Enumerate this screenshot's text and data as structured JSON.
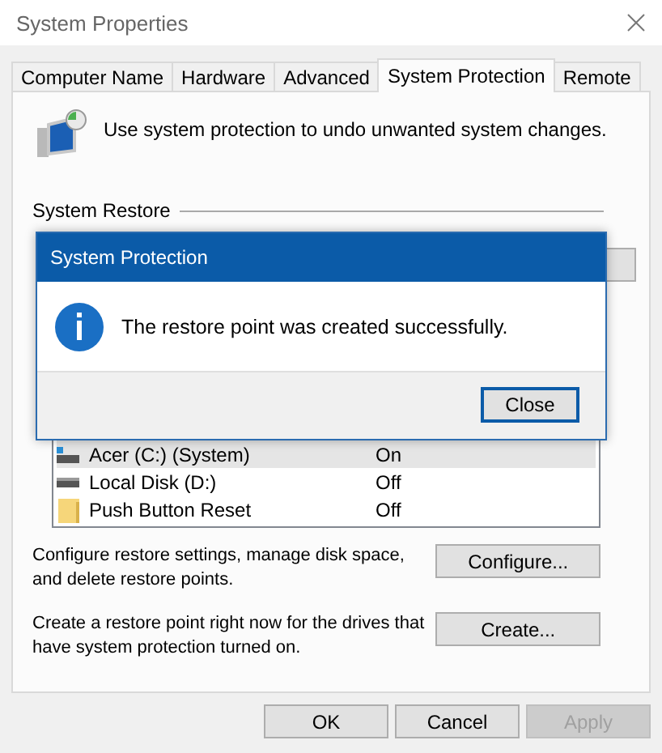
{
  "window": {
    "title": "System Properties"
  },
  "tabs": [
    {
      "label": "Computer Name",
      "selected": false
    },
    {
      "label": "Hardware",
      "selected": false
    },
    {
      "label": "Advanced",
      "selected": false
    },
    {
      "label": "System Protection",
      "selected": true
    },
    {
      "label": "Remote",
      "selected": false
    }
  ],
  "intro": "Use system protection to undo unwanted system changes.",
  "restore_group": {
    "label": "System Restore"
  },
  "drives": [
    {
      "name": "Acer (C:) (System)",
      "protection": "On",
      "kind": "system-drive",
      "selected": true
    },
    {
      "name": "Local Disk (D:)",
      "protection": "Off",
      "kind": "drive",
      "selected": false
    },
    {
      "name": "Push Button Reset",
      "protection": "Off",
      "kind": "folder",
      "selected": false
    }
  ],
  "configure": {
    "text": "Configure restore settings, manage disk space, and delete restore points.",
    "button": "Configure..."
  },
  "create": {
    "text": "Create a restore point right now for the drives that have system protection turned on.",
    "button": "Create..."
  },
  "buttons": [
    {
      "label": "OK",
      "disabled": false
    },
    {
      "label": "Cancel",
      "disabled": false
    },
    {
      "label": "Apply",
      "disabled": true
    }
  ],
  "dialog": {
    "title": "System Protection",
    "message": "The restore point was created successfully.",
    "button": "Close"
  }
}
